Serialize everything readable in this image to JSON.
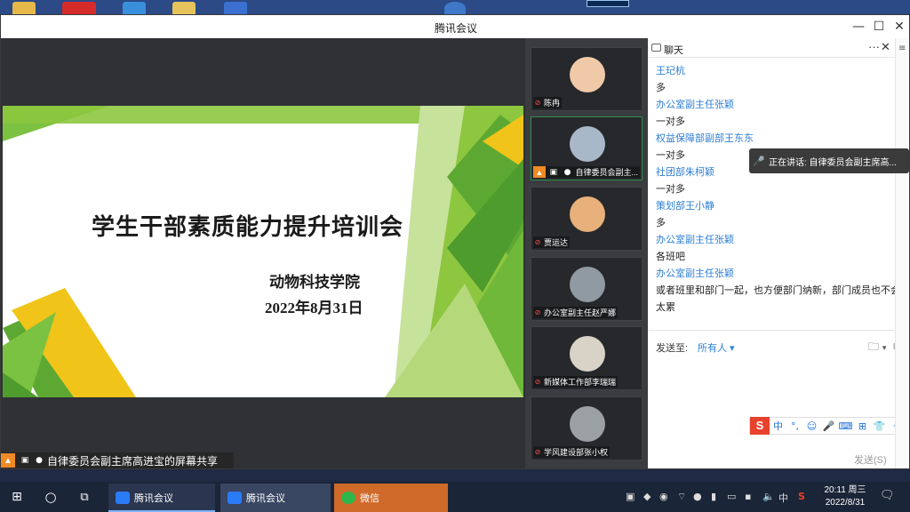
{
  "window": {
    "title": "腾讯会议",
    "minimize": "—",
    "maximize": "☐",
    "close": "✕"
  },
  "slide": {
    "title": "学生干部素质能力提升培训会",
    "subtitle": "动物科技学院",
    "date": "2022年8月31日"
  },
  "share_bar": {
    "label": "自律委员会副主席高进宝的屏幕共享"
  },
  "participants": [
    {
      "name": "陈冉",
      "muted": true,
      "avatar_color": "#f0c9a8"
    },
    {
      "name": "自律委员会副主...",
      "muted": false,
      "active": true,
      "avatar_color": "#a9b8c9"
    },
    {
      "name": "贾运达",
      "muted": true,
      "avatar_color": "#e8b07a"
    },
    {
      "name": "办公室副主任赵严娜",
      "muted": true,
      "avatar_color": "#8f9aa3"
    },
    {
      "name": "新媒体工作部李瑞瑞",
      "muted": true,
      "avatar_color": "#d8d3c6"
    },
    {
      "name": "学风建设部张小权",
      "muted": true,
      "avatar_color": "#9aa0a4"
    }
  ],
  "chat": {
    "title": "聊天",
    "more": "···",
    "close": "✕",
    "messages": [
      {
        "sender": "王玘杭",
        "text": "多"
      },
      {
        "sender": "办公室副主任张颖",
        "text": "一对多"
      },
      {
        "sender": "权益保障部副部王东东",
        "text": "一对多"
      },
      {
        "sender": "社团部朱柯颖",
        "text": "一对多"
      },
      {
        "sender": "策划部王小静",
        "text": "多"
      },
      {
        "sender": "办公室副主任张颖",
        "text": "各班吧"
      },
      {
        "sender": "办公室副主任张颖",
        "text": "或者班里和部门一起，也方便部门纳新，部门成员也不会太累"
      }
    ],
    "send_to_label": "发送至:",
    "send_target": "所有人 ▾",
    "send_button": "发送(S)",
    "send_caret": "⌄"
  },
  "speaking": {
    "text": "正在讲话: 自律委员会副主席高..."
  },
  "ime": {
    "logo": "S",
    "items": [
      "中",
      "°,",
      "☺",
      "🎤",
      "⌨",
      "⊞",
      "👕",
      "⁘"
    ]
  },
  "taskbar": {
    "apps": [
      {
        "label": "腾讯会议",
        "color": "#2a7bf6",
        "active": true
      },
      {
        "label": "腾讯会议",
        "color": "#2a7bf6",
        "active": false
      },
      {
        "label": "微信",
        "color": "#2fb64a",
        "highlight": true
      }
    ],
    "ime_indicator": "中",
    "time": "20:11 周三",
    "date": "2022/8/31"
  }
}
